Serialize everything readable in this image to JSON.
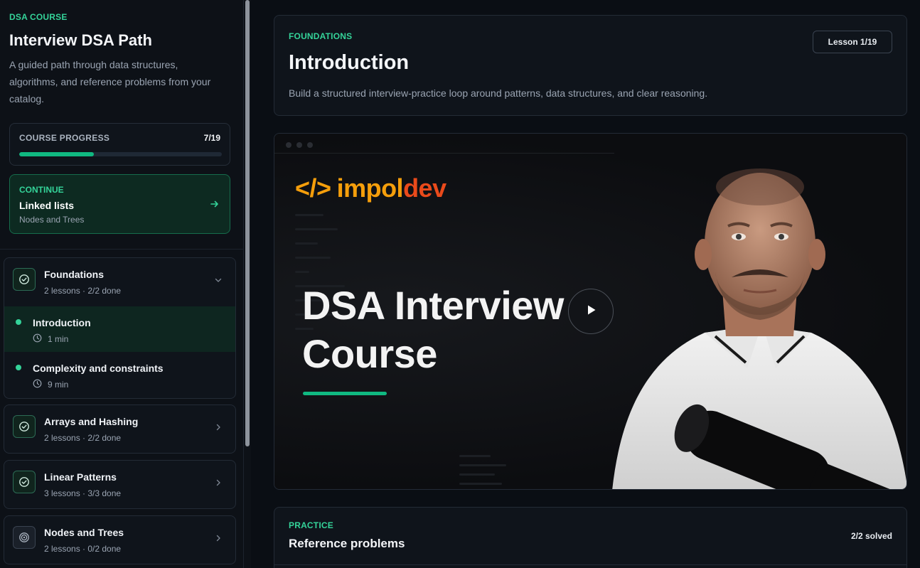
{
  "sidebar": {
    "eyebrow": "DSA COURSE",
    "title": "Interview DSA Path",
    "description": "A guided path through data structures, algorithms, and reference problems from your catalog.",
    "progress": {
      "label": "COURSE PROGRESS",
      "count": "7/19",
      "fraction": 0.368
    },
    "continue": {
      "eyebrow": "CONTINUE",
      "title": "Linked lists",
      "subtitle": "Nodes and Trees"
    },
    "sections": [
      {
        "title": "Foundations",
        "meta": "2 lessons · 2/2 done",
        "status": "done",
        "expanded": true,
        "lessons": [
          {
            "title": "Introduction",
            "duration": "1 min",
            "active": true
          },
          {
            "title": "Complexity and constraints",
            "duration": "9 min",
            "active": false
          }
        ]
      },
      {
        "title": "Arrays and Hashing",
        "meta": "2 lessons · 2/2 done",
        "status": "done"
      },
      {
        "title": "Linear Patterns",
        "meta": "3 lessons · 3/3 done",
        "status": "done"
      },
      {
        "title": "Nodes and Trees",
        "meta": "2 lessons · 0/2 done",
        "status": "in-progress"
      }
    ]
  },
  "lesson": {
    "eyebrow": "FOUNDATIONS",
    "title": "Introduction",
    "description": "Build a structured interview-practice loop around patterns, data structures, and clear reasoning.",
    "badge": "Lesson 1/19"
  },
  "video": {
    "brand_tag": "</>",
    "brand_part1": "impol",
    "brand_part2": "dev",
    "title_line1": "DSA Interview",
    "title_line2": "Course"
  },
  "practice": {
    "eyebrow": "PRACTICE",
    "title": "Reference problems",
    "count": "2/2 solved"
  },
  "colors": {
    "accent": "#34d399",
    "accent_strong": "#10b981",
    "brand_orange": "#f59e0b",
    "brand_red": "#ea4a1b",
    "background": "#0a0e14",
    "card": "#0f141b"
  }
}
